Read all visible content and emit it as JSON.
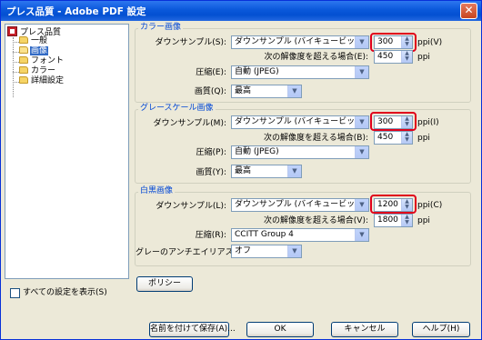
{
  "window": {
    "title": "プレス品質 - Adobe PDF 設定",
    "close_label": "✕"
  },
  "tree": {
    "root": "プレス品質",
    "children": [
      "一般",
      "画像",
      "フォント",
      "カラー",
      "詳細設定"
    ],
    "selected_index": 1
  },
  "color": {
    "title": "カラー画像",
    "downsample_label": "ダウンサンプル(S):",
    "downsample_value": "ダウンサンプル (バイキュービック法)",
    "ppi_value": "300",
    "ppi_unit": "ppi(V)",
    "above_label": "次の解像度を超える場合(E):",
    "above_value": "450",
    "above_unit": "ppi",
    "compression_label": "圧縮(E):",
    "compression_value": "自動 (JPEG)",
    "quality_label": "画質(Q):",
    "quality_value": "最高"
  },
  "gray": {
    "title": "グレースケール画像",
    "downsample_label": "ダウンサンプル(M):",
    "downsample_value": "ダウンサンプル (バイキュービック法)",
    "ppi_value": "300",
    "ppi_unit": "ppi(I)",
    "above_label": "次の解像度を超える場合(B):",
    "above_value": "450",
    "above_unit": "ppi",
    "compression_label": "圧縮(P):",
    "compression_value": "自動 (JPEG)",
    "quality_label": "画質(Y):",
    "quality_value": "最高"
  },
  "mono": {
    "title": "白黒画像",
    "downsample_label": "ダウンサンプル(L):",
    "downsample_value": "ダウンサンプル (バイキュービック法)",
    "ppi_value": "1200",
    "ppi_unit": "ppi(C)",
    "above_label": "次の解像度を超える場合(V):",
    "above_value": "1800",
    "above_unit": "ppi",
    "compression_label": "圧縮(R):",
    "compression_value": "CCITT Group 4",
    "antialias_label": "グレーのアンチエイリアス(G):",
    "antialias_value": "オフ"
  },
  "policy_button": "ポリシー",
  "show_all_label": "すべての設定を表示(S)",
  "footer": {
    "save_as": "名前を付けて保存(A)...",
    "ok": "OK",
    "cancel": "キャンセル",
    "help": "ヘルプ(H)"
  },
  "colors": {
    "highlight": "#e0001b",
    "group_title": "#0046d5",
    "selection": "#316ac5"
  }
}
